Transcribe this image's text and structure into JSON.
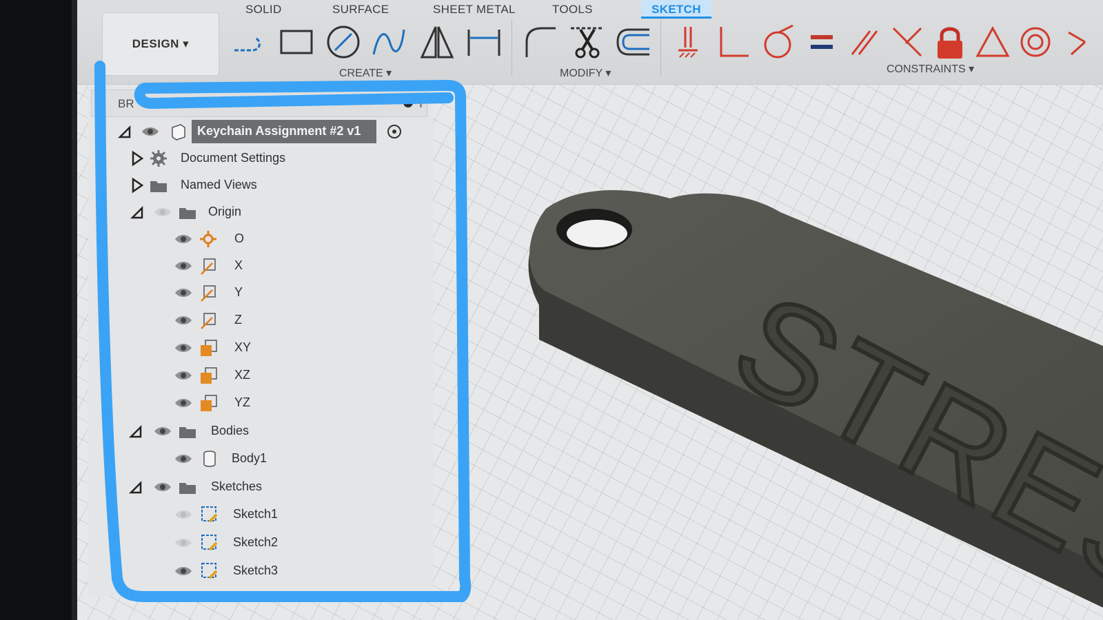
{
  "toolbar": {
    "workspace_button": "DESIGN ▾",
    "tabs": [
      {
        "label": "SOLID",
        "active": false
      },
      {
        "label": "SURFACE",
        "active": false
      },
      {
        "label": "SHEET METAL",
        "active": false
      },
      {
        "label": "TOOLS",
        "active": false
      },
      {
        "label": "SKETCH",
        "active": true
      }
    ],
    "groups": {
      "create": "CREATE ▾",
      "modify": "MODIFY ▾",
      "constraints": "CONSTRAINTS ▾"
    },
    "tools": {
      "create": [
        "line",
        "rectangle",
        "circle",
        "spline",
        "mirror",
        "dimension"
      ],
      "modify": [
        "fillet",
        "trim",
        "offset"
      ],
      "constraints": [
        "fix",
        "perpendicular-corner",
        "tangent",
        "equal",
        "parallel",
        "perpendicular",
        "lock",
        "triangle",
        "concentric",
        "more"
      ]
    },
    "accent_color": "#1d8fe6"
  },
  "browser": {
    "title": "BR",
    "root": {
      "label": "Keychain Assignment #2 v1"
    },
    "items": [
      {
        "label": "Document Settings",
        "icon": "gear-icon"
      },
      {
        "label": "Named Views",
        "icon": "folder-icon"
      },
      {
        "label": "Origin",
        "icon": "folder-icon"
      },
      {
        "label": "O",
        "icon": "origin-point-icon"
      },
      {
        "label": "X",
        "icon": "axis-icon"
      },
      {
        "label": "Y",
        "icon": "axis-icon"
      },
      {
        "label": "Z",
        "icon": "axis-icon"
      },
      {
        "label": "XY",
        "icon": "plane-icon"
      },
      {
        "label": "XZ",
        "icon": "plane-icon"
      },
      {
        "label": "YZ",
        "icon": "plane-icon"
      },
      {
        "label": "Bodies",
        "icon": "folder-icon"
      },
      {
        "label": "Body1",
        "icon": "body-icon"
      },
      {
        "label": "Sketches",
        "icon": "folder-icon"
      },
      {
        "label": "Sketch1",
        "icon": "sketch-icon"
      },
      {
        "label": "Sketch2",
        "icon": "sketch-icon"
      },
      {
        "label": "Sketch3",
        "icon": "sketch-icon"
      }
    ]
  },
  "viewport": {
    "model_text": "STRES",
    "model_color": "#4f5049",
    "annotation_color": "#3aa3f5"
  }
}
